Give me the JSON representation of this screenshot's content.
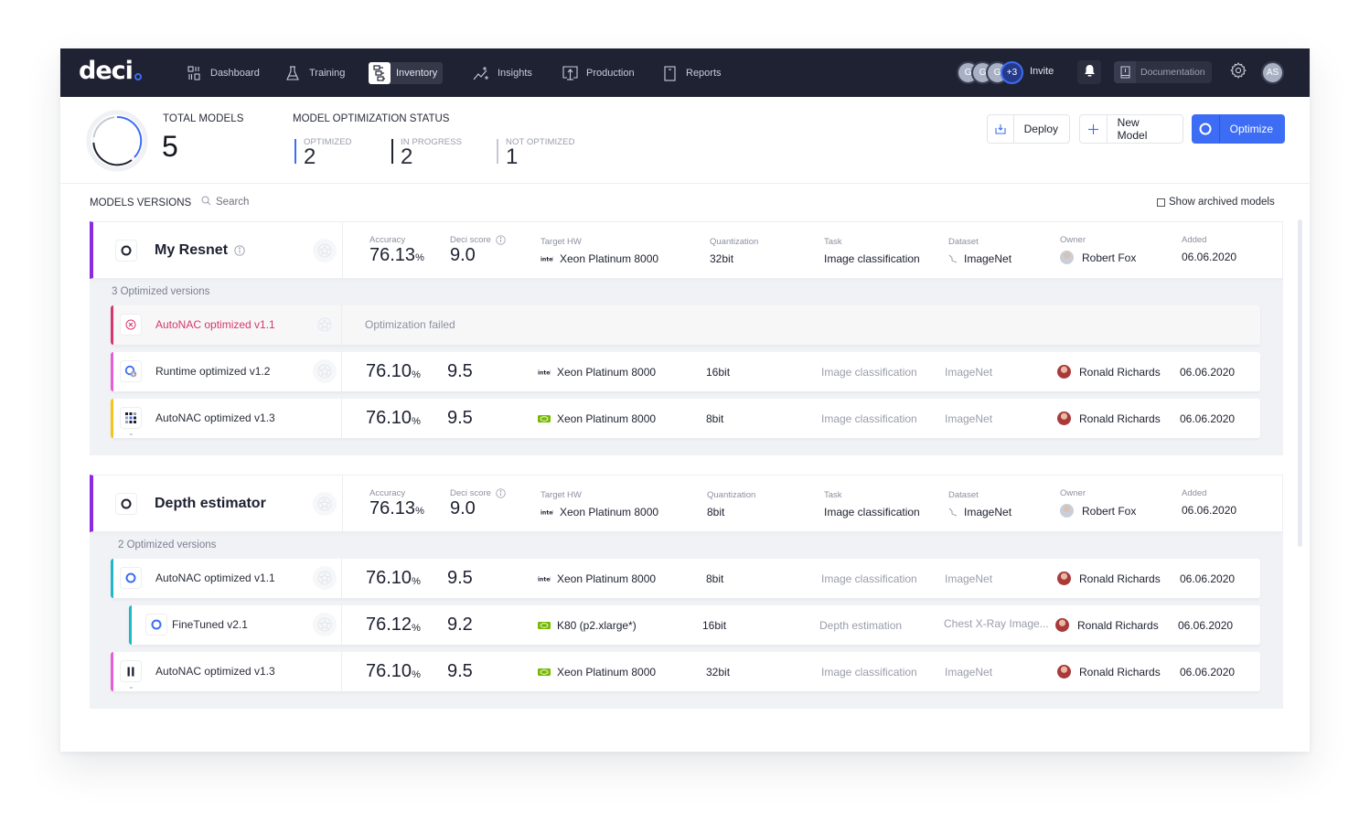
{
  "nav": {
    "logo": "deci",
    "items": [
      {
        "label": "Dashboard",
        "icon": "dashboard-icon",
        "active": false
      },
      {
        "label": "Training",
        "icon": "flask-icon",
        "active": false
      },
      {
        "label": "Inventory",
        "icon": "inventory-icon",
        "active": true
      },
      {
        "label": "Insights",
        "icon": "insights-icon",
        "active": false
      },
      {
        "label": "Production",
        "icon": "production-icon",
        "active": false
      },
      {
        "label": "Reports",
        "icon": "reports-icon",
        "active": false
      }
    ],
    "team_avatars": [
      "G",
      "G",
      "G"
    ],
    "team_more": "+3",
    "invite_label": "Invite",
    "documentation_label": "Documentation",
    "user_initials": "AS"
  },
  "summary": {
    "total_models_label": "TOTAL MODELS",
    "total_models_value": "5",
    "status_label": "MODEL OPTIMIZATION STATUS",
    "stats": [
      {
        "label": "OPTIMIZED",
        "value": "2",
        "color": "#3d6cf5"
      },
      {
        "label": "IN PROGRESS",
        "value": "2",
        "color": "#1f2230"
      },
      {
        "label": "NOT OPTIMIZED",
        "value": "1",
        "color": "#c5c8d2"
      }
    ]
  },
  "actions": {
    "deploy_label": "Deploy",
    "new_model_label": "New Model",
    "optimize_label": "Optimize"
  },
  "versions_header": {
    "title": "MODELS VERSIONS",
    "search_placeholder": "Search",
    "show_archived_label": "Show archived models",
    "show_archived_checked": false
  },
  "columns": {
    "accuracy": "Accuracy",
    "deci_score": "Deci score",
    "target_hw": "Target HW",
    "quantization": "Quantization",
    "task": "Task",
    "dataset": "Dataset",
    "owner": "Owner",
    "added": "Added"
  },
  "groups": [
    {
      "name": "My Resnet",
      "accuracy": "76.13",
      "deci_score": "9.0",
      "target_hw": "Xeon Platinum 8000",
      "hw_vendor": "intel",
      "quantization": "32bit",
      "task": "Image classification",
      "dataset": "ImageNet",
      "owner": "Robert Fox",
      "added": "06.06.2020",
      "optimized_count_label": "3 Optimized versions",
      "versions": [
        {
          "name": "AutoNAC optimized v1.1",
          "status": "failed",
          "message": "Optimization failed",
          "accent": "#d6376a"
        },
        {
          "name": "Runtime optimized v1.2",
          "status": "runtime",
          "accent": "#e85cd6",
          "accuracy": "76.10",
          "deci_score": "9.5",
          "target_hw": "Xeon Platinum 8000",
          "hw_vendor": "intel",
          "quantization": "16bit",
          "task": "Image classification",
          "dataset": "ImageNet",
          "owner": "Ronald Richards",
          "added": "06.06.2020"
        },
        {
          "name": "AutoNAC optimized v1.3",
          "status": "in-progress",
          "accent": "#f5c518",
          "accuracy": "76.10",
          "deci_score": "9.5",
          "target_hw": "Xeon Platinum 8000",
          "hw_vendor": "nvidia",
          "quantization": "8bit",
          "task": "Image classification",
          "dataset": "ImageNet",
          "owner": "Ronald Richards",
          "added": "06.06.2020"
        }
      ]
    },
    {
      "name": "Depth estimator",
      "accuracy": "76.13",
      "deci_score": "9.0",
      "target_hw": "Xeon Platinum 8000",
      "hw_vendor": "intel",
      "quantization": "8bit",
      "task": "Image classification",
      "dataset": "ImageNet",
      "owner": "Robert Fox",
      "added": "06.06.2020",
      "optimized_count_label": "2 Optimized versions",
      "versions": [
        {
          "name": "AutoNAC optimized v1.1",
          "status": "optimized",
          "accent": "#1fb8c4",
          "accuracy": "76.10",
          "deci_score": "9.5",
          "target_hw": "Xeon Platinum 8000",
          "hw_vendor": "intel",
          "quantization": "8bit",
          "task": "Image classification",
          "dataset": "ImageNet",
          "owner": "Ronald Richards",
          "added": "06.06.2020"
        },
        {
          "name": "FineTuned v2.1",
          "status": "optimized",
          "accent": "#1fb8c4",
          "accuracy": "76.12",
          "deci_score": "9.2",
          "target_hw": "K80 (p2.xlarge*)",
          "hw_vendor": "nvidia",
          "quantization": "16bit",
          "task": "Depth estimation",
          "dataset": "Chest X-Ray Image...",
          "owner": "Ronald Richards",
          "added": "06.06.2020"
        },
        {
          "name": "AutoNAC optimized v1.3",
          "status": "paused",
          "accent": "#e85cd6",
          "accuracy": "76.10",
          "deci_score": "9.5",
          "target_hw": "Xeon Platinum 8000",
          "hw_vendor": "nvidia",
          "quantization": "32bit",
          "task": "Image classification",
          "dataset": "ImageNet",
          "owner": "Ronald Richards",
          "added": "06.06.2020"
        }
      ]
    }
  ],
  "units": {
    "percent": "%"
  }
}
